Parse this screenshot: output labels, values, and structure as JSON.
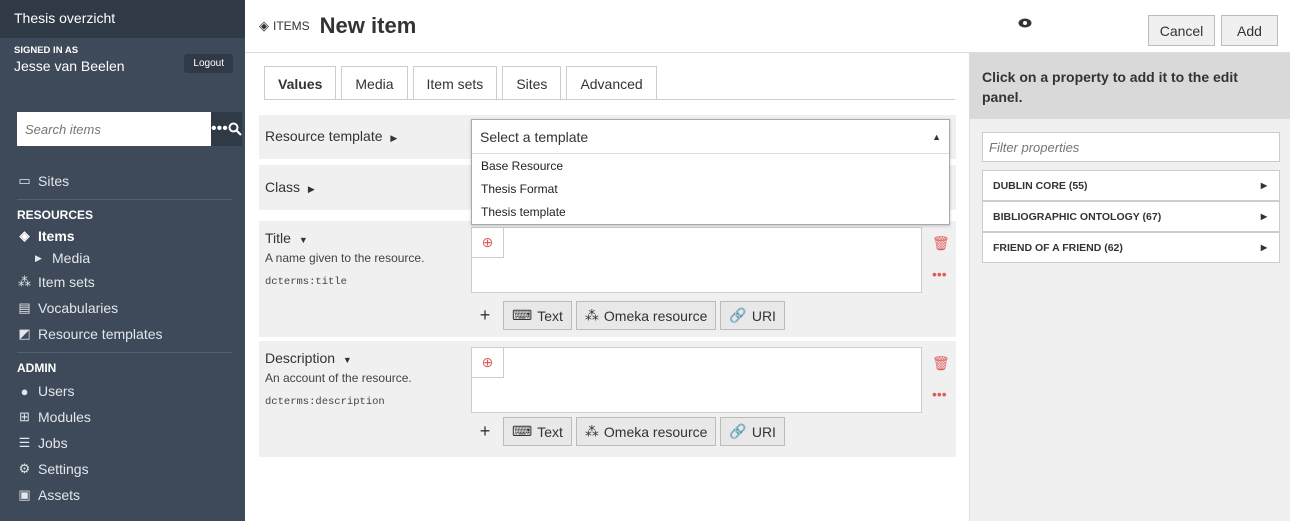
{
  "sidebar": {
    "title": "Thesis overzicht",
    "signed_in_label": "SIGNED IN AS",
    "user": "Jesse van Beelen",
    "logout": "Logout",
    "search_placeholder": "Search items",
    "sites": "Sites",
    "resources_header": "RESOURCES",
    "items": "Items",
    "media": "Media",
    "item_sets": "Item sets",
    "vocabularies": "Vocabularies",
    "resource_templates": "Resource templates",
    "admin_header": "ADMIN",
    "users": "Users",
    "modules": "Modules",
    "jobs": "Jobs",
    "settings": "Settings",
    "assets": "Assets"
  },
  "topbar": {
    "section": "ITEMS",
    "title": "New item",
    "cancel": "Cancel",
    "add": "Add"
  },
  "tabs": [
    "Values",
    "Media",
    "Item sets",
    "Sites",
    "Advanced"
  ],
  "form": {
    "resource_template_label": "Resource template",
    "class_label": "Class",
    "template_select": {
      "value": "Select a template",
      "options": [
        "Base Resource",
        "Thesis Format",
        "Thesis template"
      ]
    },
    "properties": [
      {
        "label": "Title",
        "desc": "A name given to the resource.",
        "term": "dcterms:title"
      },
      {
        "label": "Description",
        "desc": "An account of the resource.",
        "term": "dcterms:description"
      }
    ],
    "value_buttons": {
      "text": "Text",
      "omeka": "Omeka resource",
      "uri": "URI"
    }
  },
  "right_panel": {
    "message": "Click on a property to add it to the edit panel.",
    "filter_placeholder": "Filter properties",
    "vocabularies": [
      "DUBLIN CORE (55)",
      "BIBLIOGRAPHIC ONTOLOGY (67)",
      "FRIEND OF A FRIEND (62)"
    ]
  }
}
